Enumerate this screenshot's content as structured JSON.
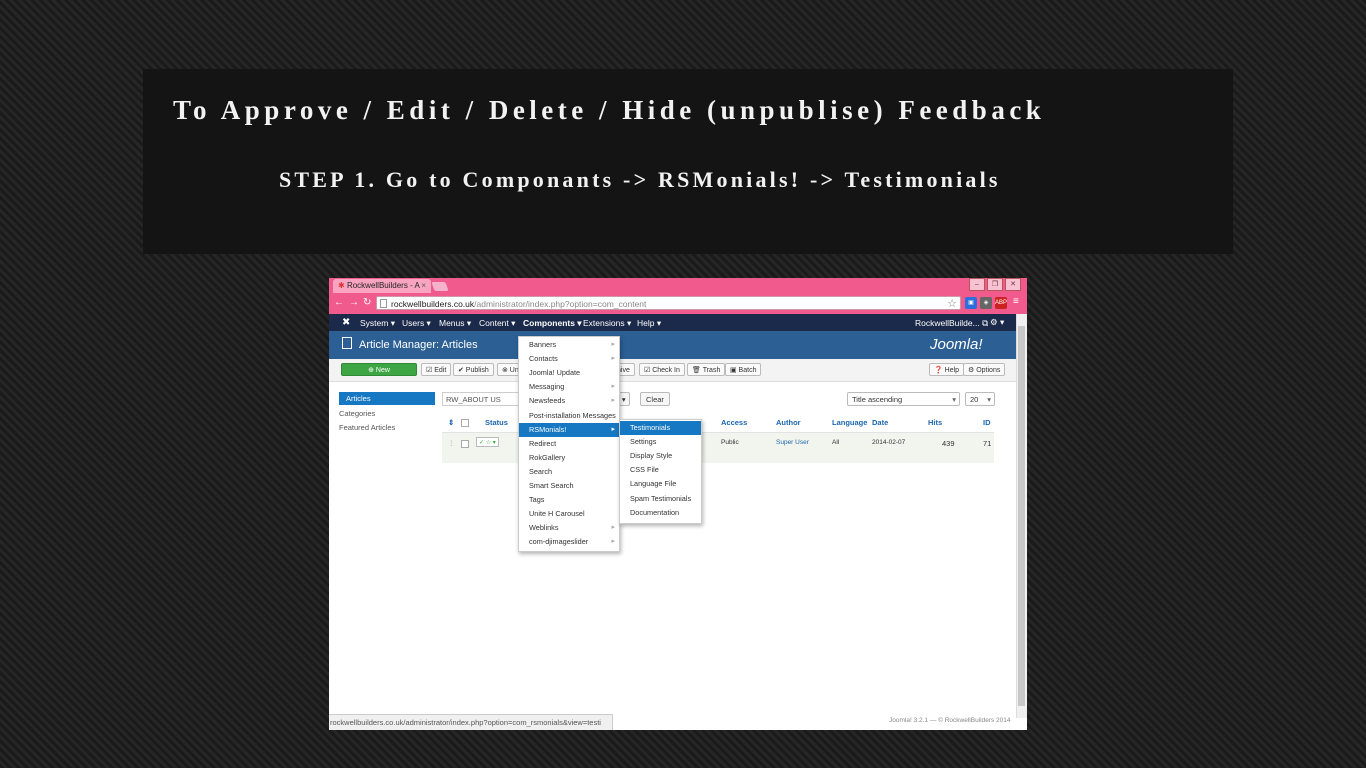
{
  "banner": {
    "title": "To Approve / Edit / Delete / Hide (unpublise) Feedback",
    "step": "STEP 1. Go to Componants -> RSMonials! -> Testimonials"
  },
  "browser": {
    "tab_title": "RockwellBuilders - A",
    "url_host": "rockwellbuilders.co.uk",
    "url_path": "/administrator/index.php?option=com_content",
    "status_url": "rockwellbuilders.co.uk/administrator/index.php?option=com_rsmonials&view=testi",
    "ext_label": "ABP"
  },
  "admin": {
    "menu": [
      "System ▾",
      "Users ▾",
      "Menus ▾",
      "Content ▾",
      "Components ▾",
      "Extensions ▾",
      "Help ▾"
    ],
    "user": "RockwellBuilde... ⧉",
    "gear": "⚙ ▾",
    "header_title": "Article Manager: Articles",
    "logo": "Joomla!",
    "toolbar": {
      "new": "⊕ New",
      "edit": "☑ Edit",
      "publish": "✔ Publish",
      "unpublish": "⊗ Un",
      "archive": "hive",
      "checkin": "☑ Check In",
      "trash": "🗑 Trash",
      "batch": "▣ Batch",
      "help": "❓ Help",
      "options": "⚙ Options"
    },
    "sidebar": [
      "Articles",
      "Categories",
      "Featured Articles"
    ],
    "search_value": "RW_ABOUT US",
    "filter_label": "s ▾",
    "clear": "Clear",
    "sort": "Title ascending",
    "limit": "20",
    "columns": {
      "order": "⇕",
      "status": "Status",
      "access": "Access",
      "author": "Author",
      "language": "Language",
      "date": "Date",
      "hits": "Hits",
      "id": "ID"
    },
    "row": {
      "status": "✓ ☆ ▾",
      "access": "Public",
      "author": "Super User",
      "language": "All",
      "date": "2014-02-07",
      "hits": "439",
      "id": "71"
    },
    "footer": "Joomla! 3.2.1 — © RockwellBuilders 2014"
  },
  "components_menu": [
    {
      "label": "Banners",
      "sub": true
    },
    {
      "label": "Contacts",
      "sub": true
    },
    {
      "label": "Joomla! Update",
      "sub": false
    },
    {
      "label": "Messaging",
      "sub": true
    },
    {
      "label": "Newsfeeds",
      "sub": true
    },
    {
      "label": "Post-installation Messages",
      "sub": false
    },
    {
      "label": "RSMonials!",
      "sub": true
    },
    {
      "label": "Redirect",
      "sub": false
    },
    {
      "label": "RokGallery",
      "sub": false
    },
    {
      "label": "Search",
      "sub": false
    },
    {
      "label": "Smart Search",
      "sub": false
    },
    {
      "label": "Tags",
      "sub": false
    },
    {
      "label": "Unite H Carousel",
      "sub": false
    },
    {
      "label": "Weblinks",
      "sub": true
    },
    {
      "label": "com-djimageslider",
      "sub": true
    }
  ],
  "rsmonials_menu": [
    "Testimonials",
    "Settings",
    "Display Style",
    "CSS File",
    "Language File",
    "Spam Testimonials",
    "Documentation"
  ],
  "colors": {
    "browser_chrome": "#f05a8c",
    "admin_nav": "#1b2a4a",
    "admin_header": "#2c5f94",
    "highlight": "#1677c2",
    "new_button": "#3ea545"
  }
}
